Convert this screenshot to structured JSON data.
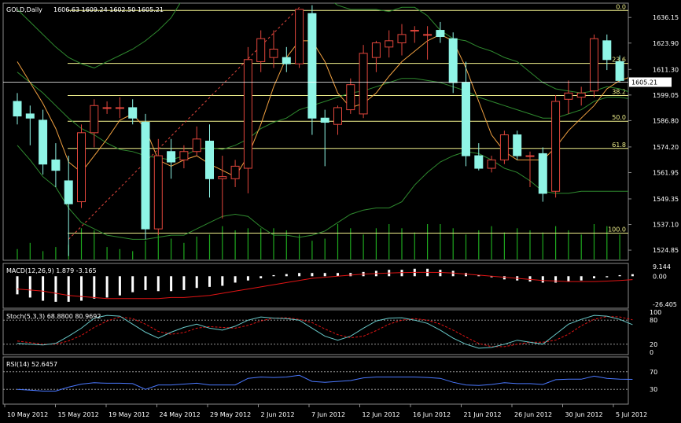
{
  "header": {
    "symbol": "GOLD,Daily",
    "ohlc": "1606.63 1609.24 1602.50 1605.21"
  },
  "colors": {
    "background": "#000000",
    "frame": "#8a8a8a",
    "bull_body": "#000000",
    "bull_border": "#e2463c",
    "bear_body": "#8ff5e6",
    "bear_border": "#8ff5e6",
    "bands": "#2f8a2f",
    "ma": "#f0a040",
    "fib": "#f0f08c",
    "volume": "#1ea81e",
    "macd_hist": "#ffffff",
    "macd_signal": "#e01414",
    "stoch_main": "#68c8c8",
    "stoch_signal": "#e01414",
    "rsi": "#4a78ff",
    "current_price": "#ffffff"
  },
  "chart_data": [
    {
      "type": "candlestick",
      "name": "price",
      "title": "GOLD,Daily",
      "ylim": [
        1520,
        1643
      ],
      "y_ticks": [
        "1636.15",
        "1623.90",
        "1611.30",
        "1599.05",
        "1586.80",
        "1574.20",
        "1561.95",
        "1549.35",
        "1537.10",
        "1524.85"
      ],
      "current_price_label": "1605.21",
      "current_price": 1605.21,
      "fib_levels": [
        {
          "label": "0.0",
          "value": 1639.5
        },
        {
          "label": "23.6",
          "value": 1614.2
        },
        {
          "label": "38.2",
          "value": 1598.8
        },
        {
          "label": "50.0",
          "value": 1586.5
        },
        {
          "label": "61.8",
          "value": 1573.5
        },
        {
          "label": "100.0",
          "value": 1533.0
        }
      ],
      "x_labels": [
        "10 May 2012",
        "15 May 2012",
        "19 May 2012",
        "24 May 2012",
        "29 May 2012",
        "2 Jun 2012",
        "7 Jun 2012",
        "12 Jun 2012",
        "16 Jun 2012",
        "21 Jun 2012",
        "26 Jun 2012",
        "30 Jun 2012",
        "5 Jul 2012"
      ],
      "candles": [
        {
          "o": 1596,
          "h": 1600,
          "l": 1585,
          "c": 1589
        },
        {
          "o": 1590,
          "h": 1594,
          "l": 1575,
          "c": 1588
        },
        {
          "o": 1587,
          "h": 1592,
          "l": 1561,
          "c": 1566
        },
        {
          "o": 1568,
          "h": 1576,
          "l": 1555,
          "c": 1563
        },
        {
          "o": 1558,
          "h": 1570,
          "l": 1522,
          "c": 1547
        },
        {
          "o": 1548,
          "h": 1585,
          "l": 1545,
          "c": 1581
        },
        {
          "o": 1581,
          "h": 1597,
          "l": 1574,
          "c": 1594
        },
        {
          "o": 1593,
          "h": 1596,
          "l": 1590,
          "c": 1593
        },
        {
          "o": 1593,
          "h": 1598,
          "l": 1588,
          "c": 1593
        },
        {
          "o": 1593,
          "h": 1597,
          "l": 1585,
          "c": 1588
        },
        {
          "o": 1586,
          "h": 1590,
          "l": 1530,
          "c": 1535
        },
        {
          "o": 1535,
          "h": 1578,
          "l": 1532,
          "c": 1570
        },
        {
          "o": 1572,
          "h": 1578,
          "l": 1559,
          "c": 1567
        },
        {
          "o": 1568,
          "h": 1575,
          "l": 1564,
          "c": 1572
        },
        {
          "o": 1572,
          "h": 1584,
          "l": 1570,
          "c": 1578
        },
        {
          "o": 1577,
          "h": 1585,
          "l": 1550,
          "c": 1559
        },
        {
          "o": 1559,
          "h": 1570,
          "l": 1540,
          "c": 1560
        },
        {
          "o": 1559,
          "h": 1568,
          "l": 1555,
          "c": 1565
        },
        {
          "o": 1564,
          "h": 1622,
          "l": 1552,
          "c": 1616
        },
        {
          "o": 1615,
          "h": 1630,
          "l": 1610,
          "c": 1626
        },
        {
          "o": 1617,
          "h": 1630,
          "l": 1612,
          "c": 1621
        },
        {
          "o": 1617,
          "h": 1622,
          "l": 1610,
          "c": 1614
        },
        {
          "o": 1614,
          "h": 1636,
          "l": 1612,
          "c": 1640
        },
        {
          "o": 1638,
          "h": 1642,
          "l": 1580,
          "c": 1588
        },
        {
          "o": 1588,
          "h": 1592,
          "l": 1565,
          "c": 1586
        },
        {
          "o": 1585,
          "h": 1594,
          "l": 1580,
          "c": 1593
        },
        {
          "o": 1592,
          "h": 1607,
          "l": 1590,
          "c": 1604
        },
        {
          "o": 1590,
          "h": 1623,
          "l": 1588,
          "c": 1619
        },
        {
          "o": 1617,
          "h": 1625,
          "l": 1610,
          "c": 1624
        },
        {
          "o": 1622,
          "h": 1630,
          "l": 1617,
          "c": 1625
        },
        {
          "o": 1624,
          "h": 1633,
          "l": 1618,
          "c": 1628
        },
        {
          "o": 1630,
          "h": 1632,
          "l": 1624,
          "c": 1630
        },
        {
          "o": 1628,
          "h": 1632,
          "l": 1616,
          "c": 1628
        },
        {
          "o": 1630,
          "h": 1634,
          "l": 1624,
          "c": 1627
        },
        {
          "o": 1626,
          "h": 1629,
          "l": 1600,
          "c": 1605
        },
        {
          "o": 1605,
          "h": 1615,
          "l": 1565,
          "c": 1570
        },
        {
          "o": 1570,
          "h": 1576,
          "l": 1563,
          "c": 1564
        },
        {
          "o": 1564,
          "h": 1570,
          "l": 1562,
          "c": 1568
        },
        {
          "o": 1568,
          "h": 1582,
          "l": 1566,
          "c": 1580
        },
        {
          "o": 1580,
          "h": 1582,
          "l": 1568,
          "c": 1570
        },
        {
          "o": 1570,
          "h": 1572,
          "l": 1555,
          "c": 1570
        },
        {
          "o": 1571,
          "h": 1574,
          "l": 1548,
          "c": 1552
        },
        {
          "o": 1553,
          "h": 1599,
          "l": 1550,
          "c": 1596
        },
        {
          "o": 1597,
          "h": 1606,
          "l": 1590,
          "c": 1600
        },
        {
          "o": 1598,
          "h": 1603,
          "l": 1594,
          "c": 1600
        },
        {
          "o": 1601,
          "h": 1628,
          "l": 1598,
          "c": 1626
        },
        {
          "o": 1625,
          "h": 1628,
          "l": 1611,
          "c": 1616
        },
        {
          "o": 1615,
          "h": 1618,
          "l": 1605,
          "c": 1606
        },
        {
          "o": 1606.63,
          "h": 1609.24,
          "l": 1602.5,
          "c": 1605.21
        }
      ],
      "volume": [
        5,
        8,
        4,
        6,
        7,
        15,
        14,
        6,
        5,
        4,
        9,
        13,
        10,
        8,
        11,
        12,
        16,
        14,
        15,
        15,
        15,
        14,
        12,
        9,
        10,
        17,
        15,
        12,
        15,
        17,
        15,
        13,
        17,
        17,
        15,
        12,
        14,
        16,
        13,
        15,
        14,
        13,
        16,
        14,
        12,
        17,
        16,
        12,
        10
      ],
      "bands_upper": [
        1640,
        1634,
        1628,
        1622,
        1617,
        1614,
        1612,
        1615,
        1618,
        1621,
        1625,
        1630,
        1636,
        1646,
        1655,
        1660,
        1660,
        1655,
        1648,
        1645,
        1645,
        1648,
        1650,
        1648,
        1646,
        1642,
        1640,
        1640,
        1640,
        1639,
        1641,
        1641,
        1637,
        1630,
        1626,
        1625,
        1622,
        1620,
        1617,
        1615,
        1610,
        1605,
        1602,
        1601,
        1600,
        1601,
        1603,
        1602,
        1600
      ],
      "bands_mid": [
        1610,
        1605,
        1600,
        1594,
        1588,
        1583,
        1580,
        1576,
        1573,
        1572,
        1570,
        1569,
        1568,
        1570,
        1573,
        1574,
        1573,
        1575,
        1578,
        1583,
        1586,
        1588,
        1592,
        1594,
        1596,
        1598,
        1600,
        1601,
        1603,
        1605,
        1607,
        1607,
        1606,
        1605,
        1603,
        1601,
        1598,
        1596,
        1594,
        1592,
        1590,
        1588,
        1588,
        1590,
        1592,
        1596,
        1598,
        1598,
        1597
      ],
      "bands_lower": [
        1575,
        1568,
        1560,
        1555,
        1545,
        1538,
        1535,
        1532,
        1531,
        1530,
        1530,
        1531,
        1532,
        1532,
        1535,
        1538,
        1541,
        1542,
        1541,
        1536,
        1532,
        1532,
        1531,
        1532,
        1534,
        1538,
        1542,
        1544,
        1545,
        1545,
        1548,
        1556,
        1562,
        1567,
        1570,
        1572,
        1571,
        1568,
        1564,
        1562,
        1558,
        1553,
        1552,
        1552,
        1553,
        1553,
        1553,
        1553,
        1553
      ],
      "ma": [
        1615,
        1605,
        1595,
        1583,
        1567,
        1562,
        1570,
        1578,
        1587,
        1590,
        1583,
        1568,
        1565,
        1568,
        1570,
        1566,
        1563,
        1560,
        1570,
        1585,
        1603,
        1617,
        1625,
        1625,
        1615,
        1600,
        1593,
        1595,
        1600,
        1608,
        1615,
        1620,
        1625,
        1628,
        1625,
        1612,
        1596,
        1580,
        1572,
        1568,
        1568,
        1568,
        1574,
        1582,
        1588,
        1594,
        1602,
        1606,
        1608
      ],
      "channel_line": [
        [
          4,
          1530
        ],
        [
          22,
          1641
        ]
      ]
    },
    {
      "type": "bar",
      "name": "macd",
      "title": "MACD(12,26,9) 1.879 -3.165",
      "ylim": [
        -30,
        12
      ],
      "y_ticks": [
        "9.144",
        "0.00",
        "-26.405"
      ],
      "histogram": [
        -17,
        -20,
        -23,
        -24,
        -24,
        -23,
        -21,
        -20,
        -18,
        -15,
        -13,
        -14,
        -14,
        -13,
        -11,
        -10,
        -9,
        -6,
        -4,
        -2,
        1,
        2,
        3,
        3,
        3,
        3,
        3,
        4,
        5,
        6,
        6,
        7,
        7,
        6,
        5,
        3,
        1,
        -1,
        -3,
        -4,
        -5,
        -6,
        -6,
        -5,
        -4,
        -2,
        -1,
        1,
        1.879
      ],
      "signal": [
        -12,
        -13,
        -14,
        -16,
        -18,
        -19,
        -20,
        -21,
        -21,
        -21,
        -21,
        -21,
        -20,
        -20,
        -19,
        -18,
        -16,
        -14,
        -12,
        -10,
        -8,
        -6,
        -4,
        -2,
        -1,
        0,
        1,
        2,
        2.5,
        3,
        3.4,
        3.6,
        3.6,
        3.5,
        3,
        2,
        1,
        0,
        -1,
        -2,
        -3,
        -4,
        -4.5,
        -5,
        -5,
        -5,
        -4.6,
        -4,
        -3.165
      ]
    },
    {
      "type": "line",
      "name": "stochastic",
      "title": "Stoch(5,3,3) 68.8800 80.9692",
      "ylim": [
        0,
        100
      ],
      "y_ticks": [
        "100",
        "80",
        "20",
        "0"
      ],
      "levels": [
        80,
        20
      ],
      "main": [
        22,
        20,
        18,
        22,
        40,
        60,
        85,
        92,
        90,
        70,
        50,
        35,
        50,
        62,
        70,
        60,
        55,
        65,
        80,
        88,
        85,
        84,
        80,
        60,
        40,
        30,
        40,
        60,
        78,
        85,
        86,
        80,
        72,
        55,
        35,
        20,
        10,
        12,
        20,
        30,
        25,
        20,
        45,
        70,
        82,
        92,
        90,
        82,
        68.88
      ],
      "signal": [
        28,
        24,
        20,
        20,
        28,
        42,
        62,
        78,
        88,
        84,
        70,
        52,
        45,
        49,
        60,
        64,
        62,
        60,
        67,
        78,
        85,
        86,
        82,
        74,
        58,
        44,
        36,
        40,
        54,
        70,
        80,
        84,
        80,
        70,
        55,
        38,
        22,
        14,
        14,
        20,
        25,
        25,
        30,
        45,
        66,
        82,
        89,
        88,
        80.97
      ]
    },
    {
      "type": "line",
      "name": "rsi",
      "title": "RSI(14) 52.6457",
      "ylim": [
        0,
        100
      ],
      "y_ticks": [
        "70",
        "30"
      ],
      "levels": [
        70,
        30
      ],
      "values": [
        30,
        28,
        26,
        26,
        35,
        42,
        45,
        44,
        44,
        43,
        30,
        40,
        40,
        42,
        44,
        40,
        40,
        40,
        55,
        58,
        57,
        58,
        62,
        48,
        46,
        48,
        50,
        56,
        58,
        58,
        58,
        58,
        57,
        55,
        46,
        40,
        39,
        41,
        45,
        43,
        43,
        41,
        52,
        53,
        53,
        60,
        55,
        53,
        52.6457
      ]
    }
  ]
}
